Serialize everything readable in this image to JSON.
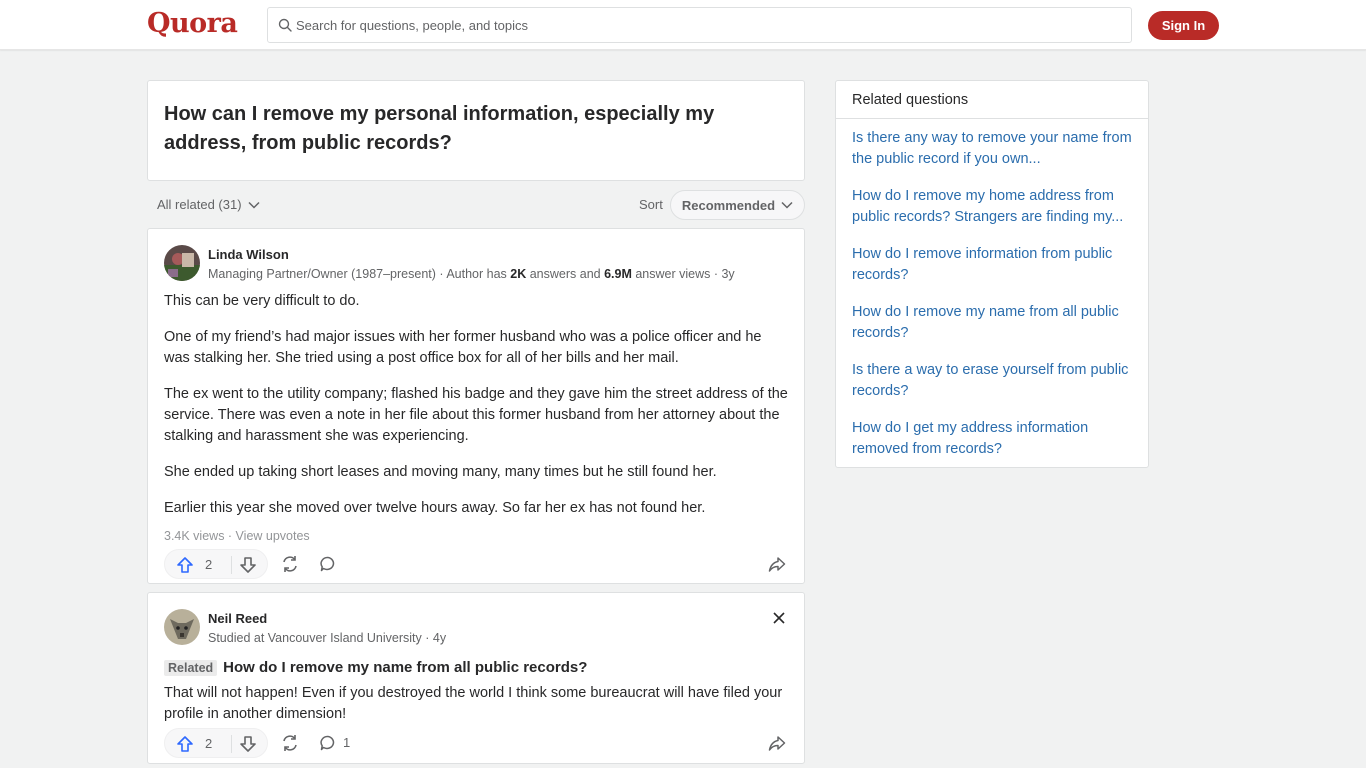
{
  "header": {
    "logo": "Quora",
    "search_placeholder": "Search for questions, people, and topics",
    "signin_label": "Sign In"
  },
  "question": {
    "title": "How can I remove my personal information, especially my address, from public records?"
  },
  "filter": {
    "all_related": "All related (31)",
    "sort_label": "Sort",
    "sort_value": "Recommended"
  },
  "answers": [
    {
      "author": "Linda Wilson",
      "cred_prefix": "Managing Partner/Owner (1987–present) · Author has ",
      "cred_answers": "2K",
      "cred_mid": " answers and ",
      "cred_views": "6.9M",
      "cred_suffix": " answer views · 3y",
      "paragraphs": [
        "This can be very difficult to do.",
        "One of my friend’s had major issues with her former husband who was a police officer and he was stalking her. She tried using a post office box for all of her bills and her mail.",
        "The ex went to the utility company; flashed his badge and they gave him the street address of the service. There was even a note in her file about this former husband from her attorney about the stalking and harassment she was experiencing.",
        "She ended up taking short leases and moving many, many times but he still found her.",
        "Earlier this year she moved over twelve hours away. So far her ex has not found her."
      ],
      "stats": "3.4K views · View upvotes",
      "upvotes": "2"
    },
    {
      "author": "Neil Reed",
      "cred": "Studied at Vancouver Island University · 4y",
      "related_badge": "Related",
      "related_question": "How do I remove my name from all public records?",
      "text": "That will not happen! Even if you destroyed the world I think some bureaucrat will have filed your profile in another dimension!",
      "upvotes": "2",
      "comments": "1"
    }
  ],
  "sidebar": {
    "title": "Related questions",
    "items": [
      "Is there any way to remove your name from the public record if you own...",
      "How do I remove my home address from public records? Strangers are finding my...",
      "How do I remove information from public records?",
      "How do I remove my name from all public records?",
      "Is there a way to erase yourself from public records?",
      "How do I get my address information removed from records?"
    ]
  },
  "colors": {
    "brand": "#b92b27",
    "link": "#2b6dad",
    "upvote": "#2e69ff"
  }
}
